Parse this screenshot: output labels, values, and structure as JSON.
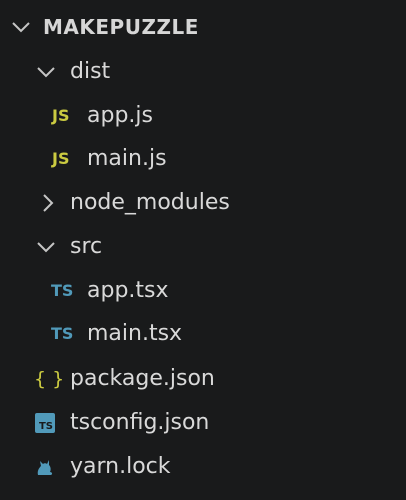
{
  "explorer": {
    "root": {
      "label": "MAKEPUZZLE",
      "expanded": true,
      "icon": "chevron-down-icon"
    },
    "items": [
      {
        "label": "dist",
        "type": "folder",
        "expanded": true,
        "icon": "chevron-down-icon"
      },
      {
        "label": "app.js",
        "type": "file",
        "icon_text": "JS",
        "icon": "javascript-file-icon"
      },
      {
        "label": "main.js",
        "type": "file",
        "icon_text": "JS",
        "icon": "javascript-file-icon"
      },
      {
        "label": "node_modules",
        "type": "folder",
        "expanded": false,
        "icon": "chevron-right-icon"
      },
      {
        "label": "src",
        "type": "folder",
        "expanded": true,
        "icon": "chevron-down-icon"
      },
      {
        "label": "app.tsx",
        "type": "file",
        "icon_text": "TS",
        "icon": "typescript-file-icon"
      },
      {
        "label": "main.tsx",
        "type": "file",
        "icon_text": "TS",
        "icon": "typescript-file-icon"
      },
      {
        "label": "package.json",
        "type": "file",
        "icon_text": "{ }",
        "icon": "json-file-icon"
      },
      {
        "label": "tsconfig.json",
        "type": "file",
        "icon_text": "TS",
        "icon": "tsconfig-file-icon"
      },
      {
        "label": "yarn.lock",
        "type": "file",
        "icon": "yarn-cat-icon"
      }
    ]
  },
  "colors": {
    "background": "#191a1b",
    "text": "#d9d9d9",
    "js": "#cbcb41",
    "ts": "#519aba",
    "json": "#cbcb41",
    "chevron": "#c5c5c5"
  }
}
